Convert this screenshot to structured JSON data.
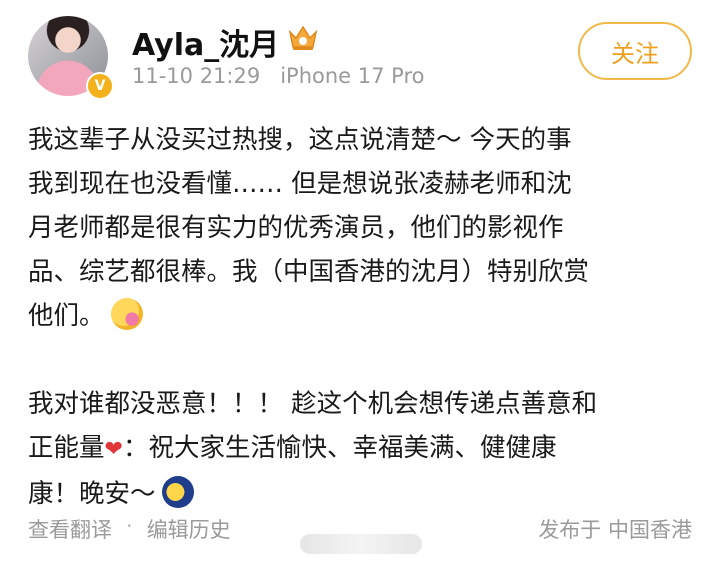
{
  "post": {
    "user": {
      "name": "Ayla_沈月",
      "verified_badge": "V",
      "avatar_icon": "avatar",
      "vip_icon": "crown-icon"
    },
    "meta": {
      "time": "11-10 21:29",
      "device": "iPhone 17 Pro"
    },
    "follow_label": "关注",
    "body": {
      "p1_lines": [
        "我这辈子从没买过热搜，这点说清楚～ 今天的事",
        "我到现在也没看懂…… 但是想说张凌赫老师和沈",
        "月老师都是很有实力的优秀演员，他们的影视作",
        "品、综艺都很棒。我（中国香港的沈月）特别欣赏",
        "他们。"
      ],
      "p2_lines": [
        "我对谁都没恶意！！！ 趁这个机会想传递点善意和"
      ],
      "p2_line2_a": "正能量",
      "p2_line2_b": "：祝大家生活愉快、幸福美满、健健康",
      "p2_line3": "康！晚安～",
      "heart": "❤"
    },
    "footer": {
      "translate": "查看翻译",
      "separator": "·",
      "edit_history": "编辑历史",
      "location": "发布于 中国香港"
    },
    "colors": {
      "accent": "#f0a020",
      "muted": "#9a9a9a",
      "heart": "#e0363a"
    }
  }
}
